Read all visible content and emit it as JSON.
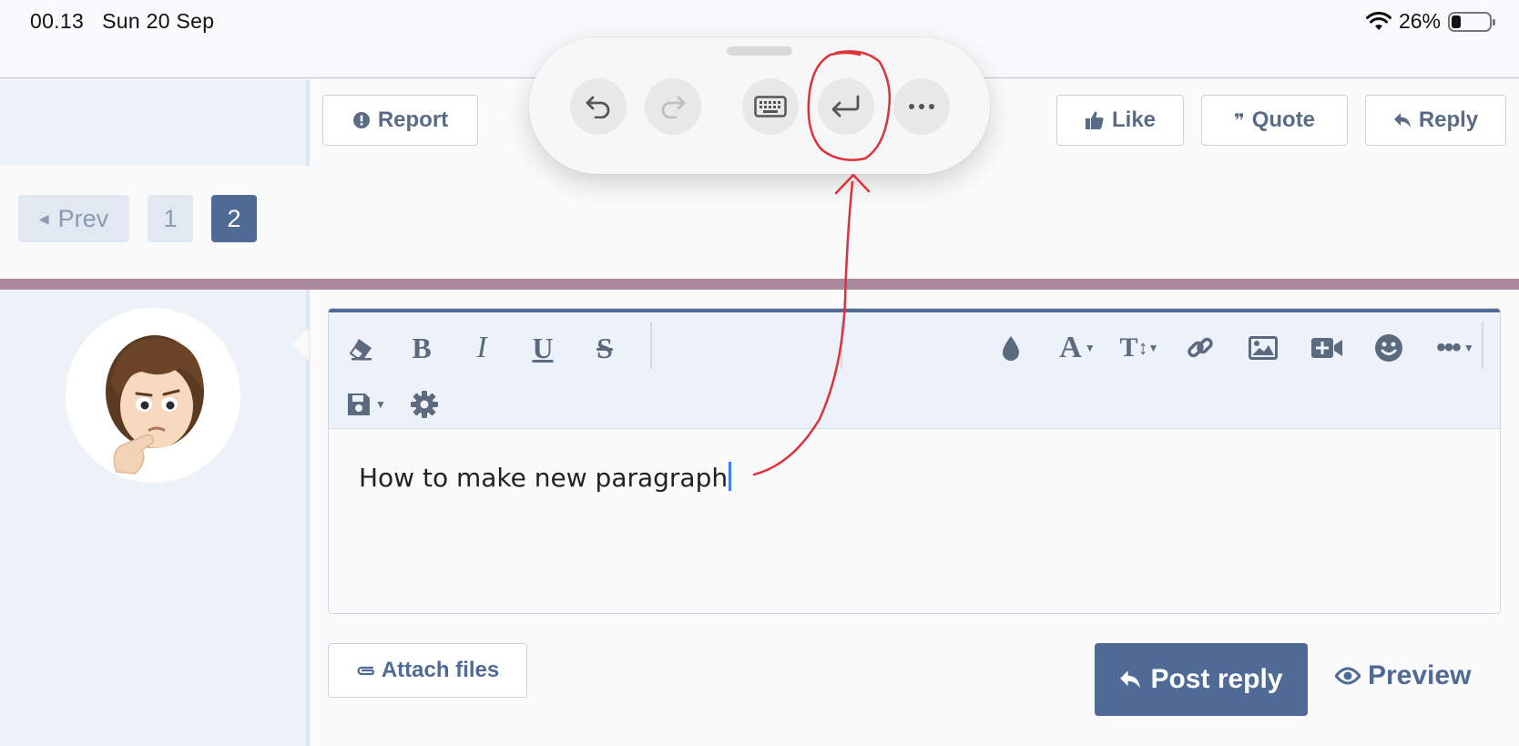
{
  "status_bar": {
    "time": "00.13",
    "date": "Sun 20 Sep",
    "battery": "26%",
    "battery_level": 0.26,
    "wifi_icon": "wifi-icon",
    "battery_icon": "battery-icon"
  },
  "post_actions": {
    "report_label": "Report",
    "like_label": "Like",
    "quote_label": "Quote",
    "reply_label": "Reply"
  },
  "pagination": {
    "prev_label": "Prev",
    "pages": [
      "1",
      "2"
    ],
    "current": "2"
  },
  "editor": {
    "text": "How to make new paragraph",
    "toolbar_icons": [
      "eraser-icon",
      "bold-icon",
      "italic-icon",
      "underline-icon",
      "strikethrough-icon",
      "text-color-icon",
      "font-family-icon",
      "font-size-icon",
      "link-icon",
      "image-icon",
      "video-icon",
      "emoji-icon",
      "more-icon",
      "align-icon",
      "list-icon",
      "table-icon",
      "undo-icon",
      "redo-icon",
      "drafts-icon",
      "settings-icon"
    ]
  },
  "footer": {
    "attach_label": "Attach files",
    "post_reply_label": "Post reply",
    "preview_label": "Preview"
  },
  "shortcut_palette": {
    "buttons": [
      "undo-icon",
      "redo-icon",
      "keyboard-icon",
      "return-icon",
      "ellipsis-icon"
    ]
  },
  "colors": {
    "accent": "#4f6a94",
    "stripe": "#ab8a9f",
    "panel": "#edf1f8",
    "annotation": "#e0303a"
  }
}
